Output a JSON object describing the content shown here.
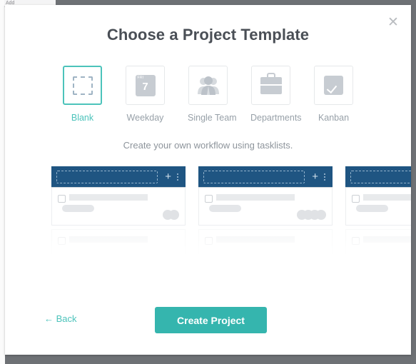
{
  "background": {
    "artifact_text": "Add"
  },
  "modal": {
    "title": "Choose a Project Template",
    "close_icon": "close-icon",
    "subtitle": "Create your own workflow using tasklists.",
    "templates": [
      {
        "label": "Blank",
        "icon": "dashed-square-icon",
        "selected": true
      },
      {
        "label": "Weekday",
        "icon": "calendar-icon",
        "selected": false,
        "cal_dow": "FRI",
        "cal_day": "7"
      },
      {
        "label": "Single Team",
        "icon": "people-group-icon",
        "selected": false
      },
      {
        "label": "Departments",
        "icon": "briefcase-icon",
        "selected": false
      },
      {
        "label": "Kanban",
        "icon": "checkbox-pen-icon",
        "selected": false
      }
    ],
    "preview": {
      "columns": [
        {
          "add_icon": "plus-icon",
          "menu_icon": "more-vertical-icon",
          "avatar_count": 2
        },
        {
          "add_icon": "plus-icon",
          "menu_icon": "more-vertical-icon",
          "avatar_count": 4
        },
        {
          "add_icon": "plus-icon",
          "menu_icon": "more-vertical-icon",
          "avatar_count": 0
        }
      ]
    },
    "footer": {
      "back_label": "← Back",
      "create_label": "Create Project"
    }
  },
  "colors": {
    "accent_teal": "#4cc3bb",
    "button_teal": "#35b5ae",
    "column_blue": "#1f5582",
    "title_gray": "#4a4f56",
    "muted_gray": "#97a0a8"
  }
}
